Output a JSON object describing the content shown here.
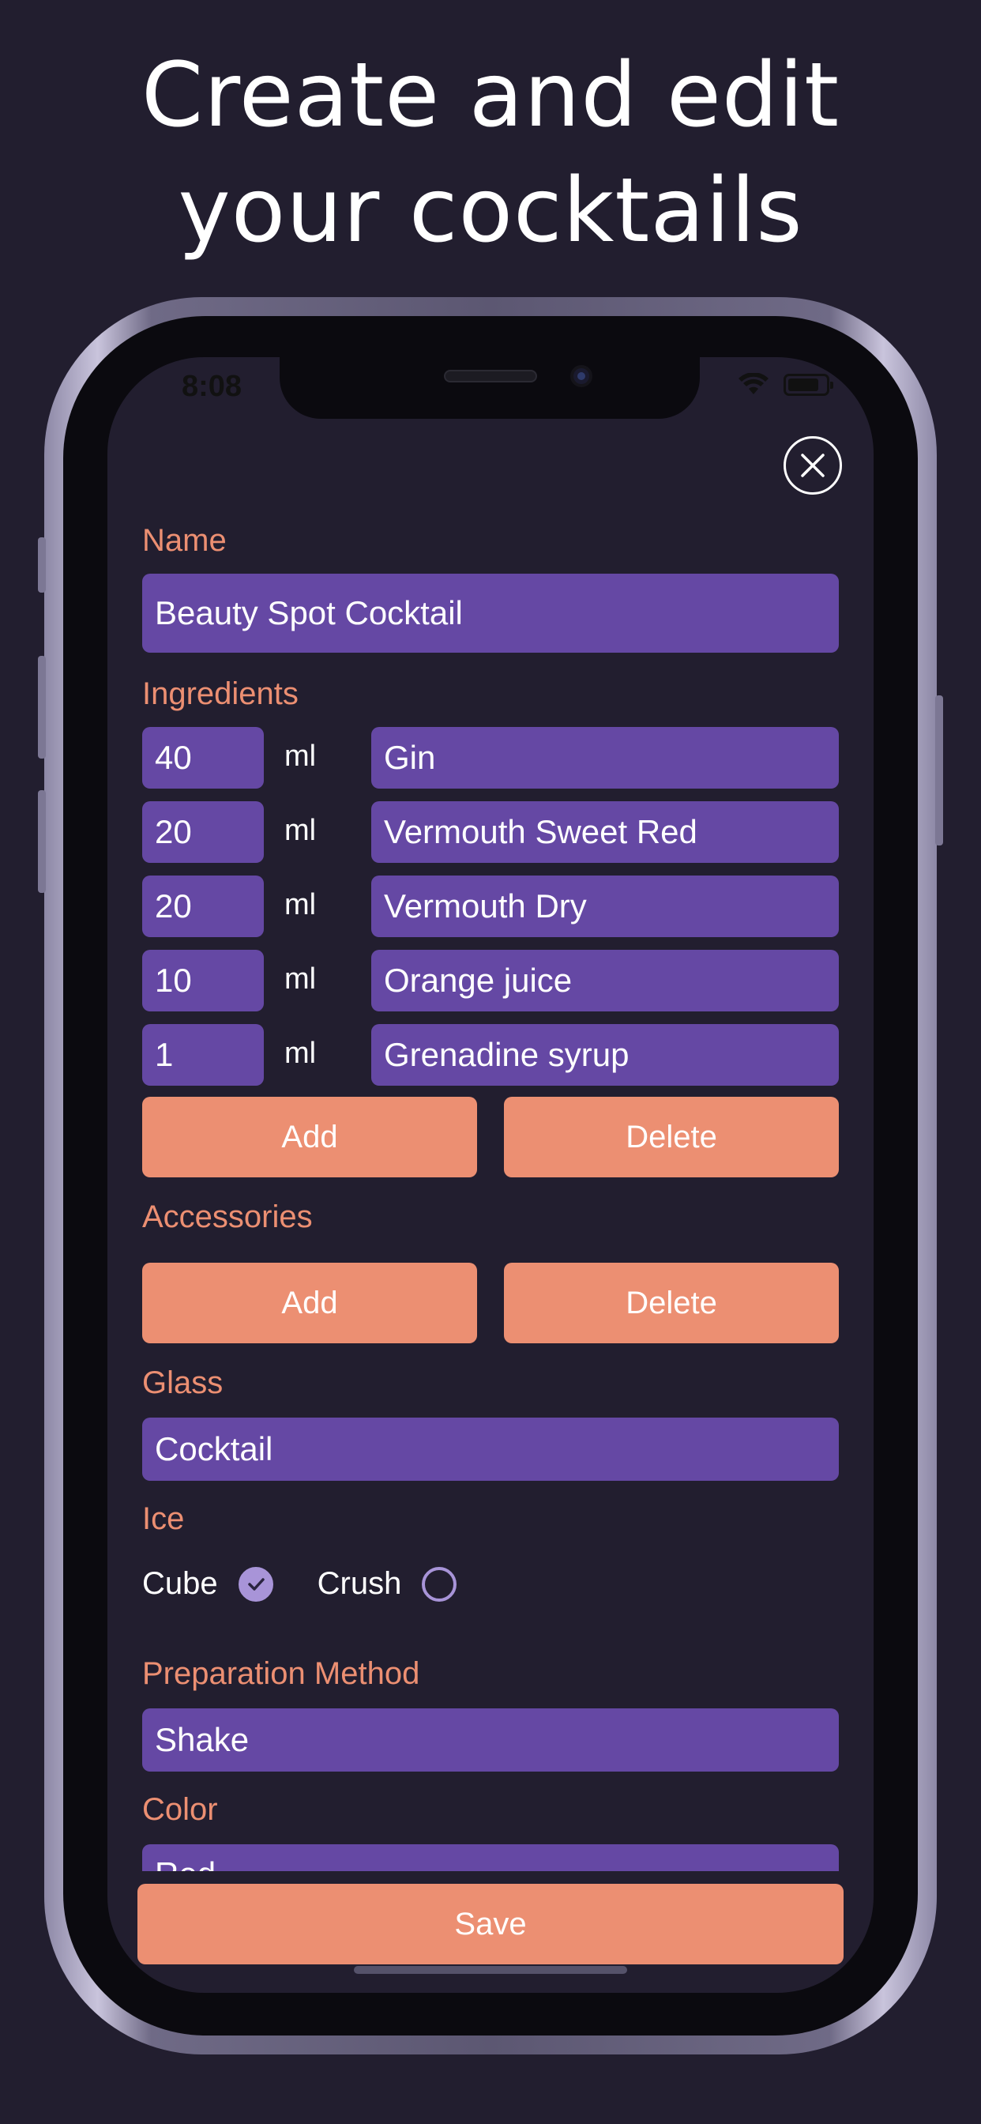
{
  "headline": {
    "line1": "Create and edit",
    "line2": "your cocktails"
  },
  "status": {
    "time": "8:08"
  },
  "form": {
    "name_label": "Name",
    "name_value": "Beauty Spot Cocktail",
    "ingredients_label": "Ingredients",
    "ingredients": [
      {
        "amount": "40",
        "unit": "ml",
        "name": "Gin"
      },
      {
        "amount": "20",
        "unit": "ml",
        "name": "Vermouth Sweet Red"
      },
      {
        "amount": "20",
        "unit": "ml",
        "name": "Vermouth Dry"
      },
      {
        "amount": "10",
        "unit": "ml",
        "name": "Orange juice"
      },
      {
        "amount": "1",
        "unit": "ml",
        "name": "Grenadine syrup"
      }
    ],
    "ingredients_add": "Add",
    "ingredients_delete": "Delete",
    "accessories_label": "Accessories",
    "accessories_add": "Add",
    "accessories_delete": "Delete",
    "glass_label": "Glass",
    "glass_value": "Cocktail",
    "ice_label": "Ice",
    "ice_options": [
      {
        "label": "Cube",
        "checked": true
      },
      {
        "label": "Crush",
        "checked": false
      }
    ],
    "method_label": "Preparation Method",
    "method_value": "Shake",
    "color_label": "Color",
    "color_value": "Red",
    "save": "Save"
  },
  "colors": {
    "background": "#221e2f",
    "field": "#6548a4",
    "accent": "#ec8f72",
    "radio": "#a894d8"
  },
  "icons": {
    "close": "close-icon",
    "check": "check-icon",
    "wifi": "wifi-icon",
    "battery": "battery-icon"
  }
}
